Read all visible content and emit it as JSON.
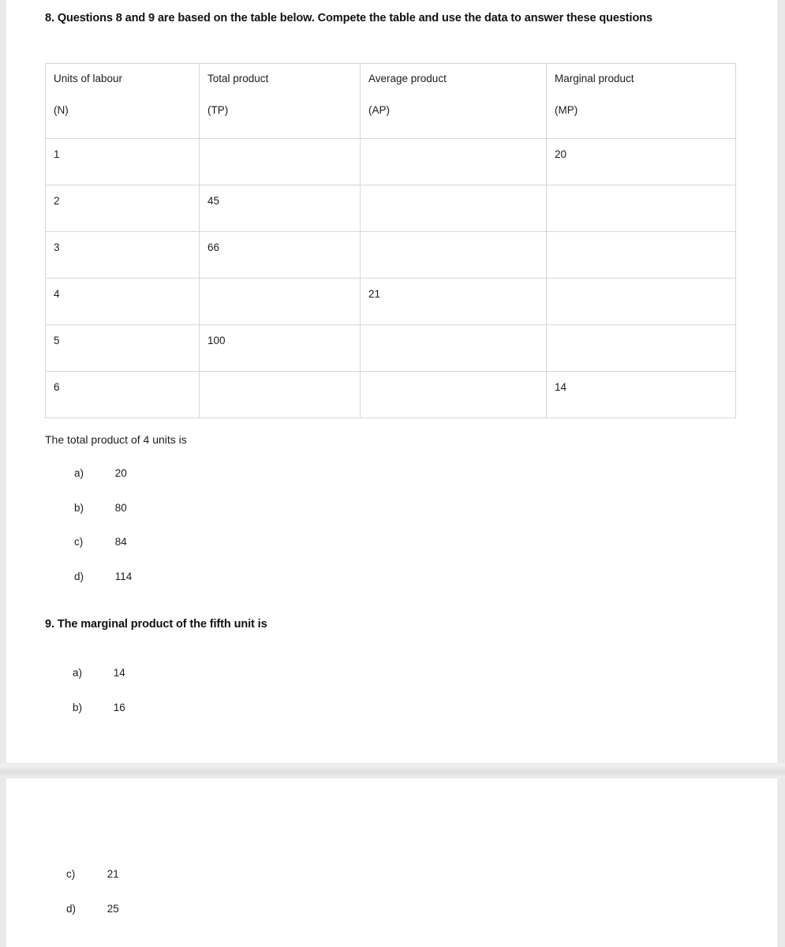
{
  "document": {
    "page_count": 2
  },
  "question8": {
    "heading": "8. Questions 8 and 9 are based on the table below. Compete the table and use the data to answer these questions",
    "prompt": "The total product of 4 units is",
    "table": {
      "headers": [
        {
          "line1": "Units of labour",
          "line2": "(N)"
        },
        {
          "line1": "Total product",
          "line2": "(TP)"
        },
        {
          "line1": "Average product",
          "line2": "(AP)"
        },
        {
          "line1": "Marginal product",
          "line2": "(MP)"
        }
      ],
      "rows": [
        {
          "n": "1",
          "tp": "",
          "ap": "",
          "mp": "20"
        },
        {
          "n": "2",
          "tp": "45",
          "ap": "",
          "mp": ""
        },
        {
          "n": "3",
          "tp": "66",
          "ap": "",
          "mp": ""
        },
        {
          "n": "4",
          "tp": "",
          "ap": "21",
          "mp": ""
        },
        {
          "n": "5",
          "tp": "100",
          "ap": "",
          "mp": ""
        },
        {
          "n": "6",
          "tp": "",
          "ap": "",
          "mp": "14"
        }
      ]
    },
    "options": [
      {
        "letter": "a)",
        "value": "20"
      },
      {
        "letter": "b)",
        "value": "80"
      },
      {
        "letter": "c)",
        "value": "84"
      },
      {
        "letter": "d)",
        "value": "114"
      }
    ]
  },
  "question9": {
    "heading": "9. The marginal product of the fifth unit is",
    "options_page1": [
      {
        "letter": "a)",
        "value": "14"
      },
      {
        "letter": "b)",
        "value": "16"
      }
    ],
    "options_page2": [
      {
        "letter": "c)",
        "value": "21"
      },
      {
        "letter": "d)",
        "value": "25"
      }
    ]
  }
}
